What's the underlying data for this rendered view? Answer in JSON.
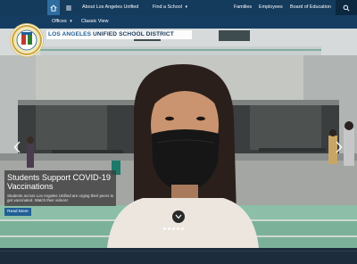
{
  "topnav": {
    "items": [
      "About Los Angeles Unified",
      "Find a School",
      "Families",
      "Employees",
      "Board of Education"
    ]
  },
  "subnav": {
    "items": [
      "Offices",
      "Classic View"
    ]
  },
  "banner": {
    "part1": "LOS ANGELES",
    "part2": " UNIFIED SCHOOL DISTRICT"
  },
  "slide": {
    "title": "Students Support COVID-19 Vaccinations",
    "description": "Students across Los Angeles Unified are urging their peers to get vaccinated. Watch their videos!",
    "button": "Read More",
    "total_slides": 5,
    "active_slide": 1
  },
  "icons": {
    "home": "home-icon",
    "menu": "menu-icon",
    "search": "search-icon",
    "prev": "chevron-left-icon",
    "next": "chevron-right-icon",
    "scroll": "chevron-down-icon"
  },
  "colors": {
    "nav": "#143a5c",
    "accent": "#1f5f96"
  }
}
